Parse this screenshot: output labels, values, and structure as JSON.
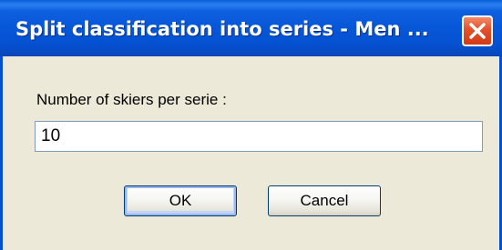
{
  "dialog": {
    "title": "Split classification into series - Men ...",
    "prompt_label": "Number of skiers per serie :",
    "input_value": "10",
    "ok_label": "OK",
    "cancel_label": "Cancel"
  },
  "icons": {
    "close": "close-icon"
  },
  "colors": {
    "titlebar": "#0657d8",
    "close_button": "#e4502a",
    "dialog_background": "#ece9d8",
    "input_border": "#7f9db9",
    "button_border": "#003c74"
  }
}
